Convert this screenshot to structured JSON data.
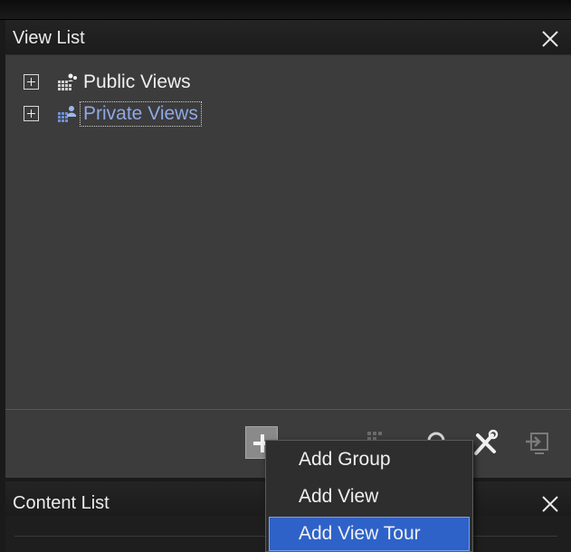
{
  "view_list": {
    "title": "View List",
    "items": [
      {
        "label": "Public Views",
        "icon": "public-views-icon",
        "selected": false
      },
      {
        "label": "Private Views",
        "icon": "private-views-icon",
        "selected": true
      }
    ]
  },
  "toolbar": {
    "buttons": [
      {
        "name": "add",
        "icon": "plus-icon"
      },
      {
        "name": "edit",
        "icon": "edit-icon"
      },
      {
        "name": "refresh",
        "icon": "refresh-icon"
      },
      {
        "name": "tools",
        "icon": "wrench-icon"
      },
      {
        "name": "export",
        "icon": "export-icon"
      }
    ]
  },
  "context_menu": {
    "items": [
      {
        "label": "Add Group"
      },
      {
        "label": "Add View"
      },
      {
        "label": "Add View Tour",
        "highlighted": true
      }
    ]
  },
  "content_list": {
    "title": "Content List"
  },
  "colors": {
    "panel_bg": "#3c3c3c",
    "selected_text": "#8fa8e6",
    "menu_highlight": "#2e62c9"
  }
}
